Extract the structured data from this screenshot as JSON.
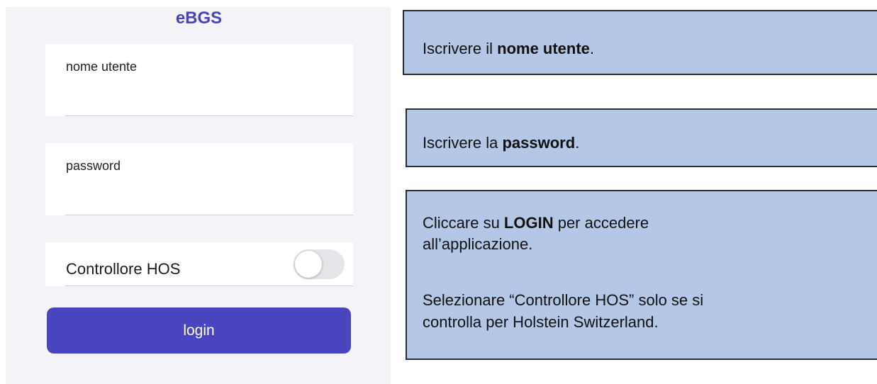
{
  "app": {
    "title": "eBGS"
  },
  "form": {
    "username": {
      "label": "nome utente",
      "value": ""
    },
    "password": {
      "label": "password",
      "value": ""
    },
    "hos_toggle": {
      "label": "Controllore HOS",
      "on": false
    },
    "login_label": "login"
  },
  "instructions": {
    "username": {
      "prefix": "Iscrivere il ",
      "bold": "nome utente",
      "suffix": "."
    },
    "password": {
      "prefix": "Iscrivere la ",
      "bold": "password",
      "suffix": "."
    },
    "login": {
      "prefix": "Cliccare su ",
      "bold": "LOGIN",
      "suffix_line1": " per accedere",
      "line2": "all’applicazione.",
      "hos_line1": "Selezionare “Controllore HOS” solo se si",
      "hos_line2": "controlla per Holstein Switzerland."
    }
  },
  "colors": {
    "accent": "#4a45bf",
    "callout_background": "#b4c7e7",
    "panel_background": "#f3f3f8"
  }
}
